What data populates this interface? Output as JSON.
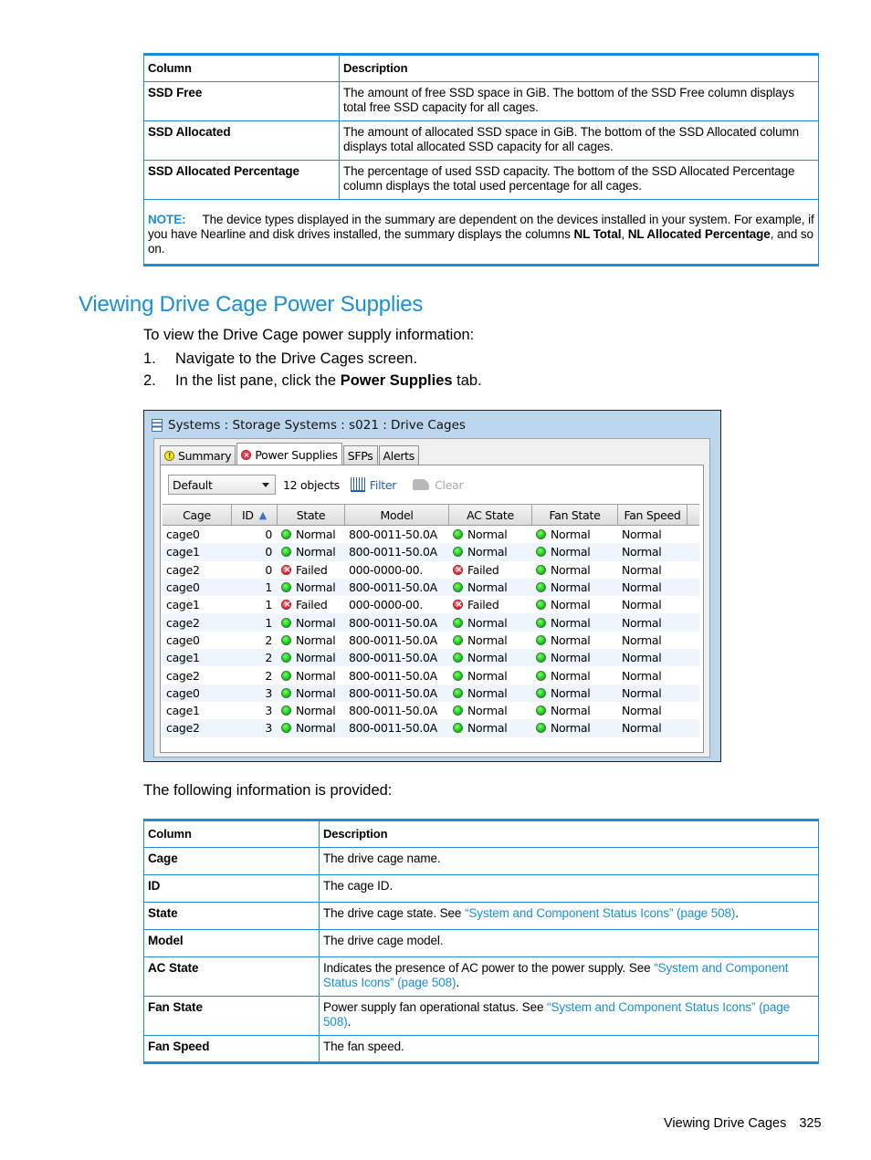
{
  "top_table": {
    "headers": [
      "Column",
      "Description"
    ],
    "rows": [
      {
        "column": "SSD Free",
        "description": "The amount of free SSD space in GiB. The bottom of the SSD Free column displays total free SSD capacity for all cages."
      },
      {
        "column": "SSD Allocated",
        "description": "The amount of allocated SSD space in GiB. The bottom of the SSD Allocated column displays total allocated SSD capacity for all cages."
      },
      {
        "column": "SSD Allocated Percentage",
        "description": "The percentage of used SSD capacity. The bottom of the SSD Allocated Percentage column displays the total used percentage for all cages."
      }
    ],
    "note": {
      "label": "NOTE:",
      "text_before": "The device types displayed in the summary are dependent on the devices installed in your system. For example, if you have Nearline and disk drives installed, the summary displays the columns ",
      "bold1": "NL Total",
      "sep": ", ",
      "bold2": "NL Allocated Percentage",
      "text_after": ", and so on."
    }
  },
  "section": {
    "title": "Viewing Drive Cage Power Supplies",
    "intro": "To view the Drive Cage power supply information:",
    "steps": [
      {
        "num": "1.",
        "text": "Navigate to the Drive Cages screen."
      },
      {
        "num": "2.",
        "text_before": "In the list pane, click the ",
        "bold": "Power Supplies",
        "text_after": " tab."
      }
    ]
  },
  "screenshot": {
    "title": "Systems : Storage Systems : s021 : Drive Cages",
    "tabs": [
      {
        "label": "Summary",
        "icon": "warning-icon"
      },
      {
        "label": "Power Supplies",
        "icon": "error-icon",
        "active": true
      },
      {
        "label": "SFPs"
      },
      {
        "label": "Alerts"
      }
    ],
    "view_select": "Default",
    "object_count": "12 objects",
    "filter_label": "Filter",
    "clear_label": "Clear",
    "columns": [
      "Cage",
      "ID",
      "State",
      "Model",
      "AC State",
      "Fan State",
      "Fan Speed"
    ],
    "sort_indicator": "▲",
    "rows": [
      {
        "cage": "cage0",
        "id": "0",
        "state": "Normal",
        "model": "800-0011-50.0A",
        "ac": "Normal",
        "fan": "Normal",
        "speed": "Normal"
      },
      {
        "cage": "cage1",
        "id": "0",
        "state": "Normal",
        "model": "800-0011-50.0A",
        "ac": "Normal",
        "fan": "Normal",
        "speed": "Normal"
      },
      {
        "cage": "cage2",
        "id": "0",
        "state": "Failed",
        "model": "000-0000-00.",
        "ac": "Failed",
        "fan": "Normal",
        "speed": "Normal"
      },
      {
        "cage": "cage0",
        "id": "1",
        "state": "Normal",
        "model": "800-0011-50.0A",
        "ac": "Normal",
        "fan": "Normal",
        "speed": "Normal"
      },
      {
        "cage": "cage1",
        "id": "1",
        "state": "Failed",
        "model": "000-0000-00.",
        "ac": "Failed",
        "fan": "Normal",
        "speed": "Normal"
      },
      {
        "cage": "cage2",
        "id": "1",
        "state": "Normal",
        "model": "800-0011-50.0A",
        "ac": "Normal",
        "fan": "Normal",
        "speed": "Normal"
      },
      {
        "cage": "cage0",
        "id": "2",
        "state": "Normal",
        "model": "800-0011-50.0A",
        "ac": "Normal",
        "fan": "Normal",
        "speed": "Normal"
      },
      {
        "cage": "cage1",
        "id": "2",
        "state": "Normal",
        "model": "800-0011-50.0A",
        "ac": "Normal",
        "fan": "Normal",
        "speed": "Normal"
      },
      {
        "cage": "cage2",
        "id": "2",
        "state": "Normal",
        "model": "800-0011-50.0A",
        "ac": "Normal",
        "fan": "Normal",
        "speed": "Normal"
      },
      {
        "cage": "cage0",
        "id": "3",
        "state": "Normal",
        "model": "800-0011-50.0A",
        "ac": "Normal",
        "fan": "Normal",
        "speed": "Normal"
      },
      {
        "cage": "cage1",
        "id": "3",
        "state": "Normal",
        "model": "800-0011-50.0A",
        "ac": "Normal",
        "fan": "Normal",
        "speed": "Normal"
      },
      {
        "cage": "cage2",
        "id": "3",
        "state": "Normal",
        "model": "800-0011-50.0A",
        "ac": "Normal",
        "fan": "Normal",
        "speed": "Normal"
      }
    ]
  },
  "info_intro": "The following information is provided:",
  "bottom_table": {
    "headers": [
      "Column",
      "Description"
    ],
    "rows": [
      {
        "column": "Cage",
        "description": "The drive cage name."
      },
      {
        "column": "ID",
        "description": "The cage ID."
      },
      {
        "column": "State",
        "description": "The drive cage state. See ",
        "link": "“System and Component Status Icons” (page 508)",
        "after": "."
      },
      {
        "column": "Model",
        "description": "The drive cage model."
      },
      {
        "column": "AC State",
        "description": "Indicates the presence of AC power to the power supply. See ",
        "link": "“System and Component Status Icons” (page 508)",
        "after": "."
      },
      {
        "column": "Fan State",
        "description": "Power supply fan operational status. See ",
        "link": "“System and Component Status Icons” (page 508)",
        "after": "."
      },
      {
        "column": "Fan Speed",
        "description": "The fan speed."
      }
    ]
  },
  "footer": {
    "section": "Viewing Drive Cages",
    "page": "325"
  },
  "colors": {
    "accent": "#1a8fd6",
    "ok": "#18c81a",
    "fail": "#e0303c",
    "link": "#1a8fd6"
  }
}
